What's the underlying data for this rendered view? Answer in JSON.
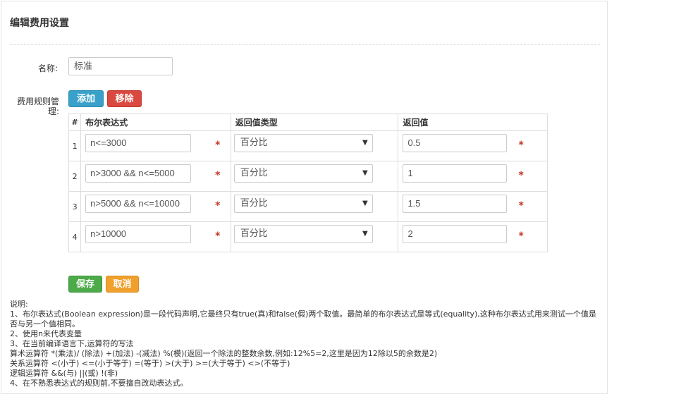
{
  "panel": {
    "title": "编辑费用设置"
  },
  "form": {
    "name_label": "名称:",
    "name_value": "标准",
    "rules_label": "费用规则管理:",
    "add_label": "添加",
    "remove_label": "移除",
    "save_label": "保存",
    "cancel_label": "取消"
  },
  "table": {
    "headers": {
      "index": "#",
      "expression": "布尔表达式",
      "return_type": "返回值类型",
      "return_value": "返回值"
    },
    "required_mark": "*",
    "rows": [
      {
        "index": "1",
        "expression": "n<=3000",
        "return_type": "百分比",
        "return_value": "0.5"
      },
      {
        "index": "2",
        "expression": "n>3000 && n<=5000",
        "return_type": "百分比",
        "return_value": "1"
      },
      {
        "index": "3",
        "expression": "n>5000 && n<=10000",
        "return_type": "百分比",
        "return_value": "1.5"
      },
      {
        "index": "4",
        "expression": "n>10000",
        "return_type": "百分比",
        "return_value": "2"
      }
    ]
  },
  "notes": [
    "说明:",
    "1、布尔表达式(Boolean expression)是一段代码声明,它最终只有true(真)和false(假)两个取值。最简单的布尔表达式是等式(equality),这种布尔表达式用来测试一个值是否与另一个值相同。",
    "2、使用n来代表变量",
    "3、在当前编译语言下,运算符的写法",
    "算术运算符 *(乘法)/ (除法) +(加法) -(减法) %(模)(返回一个除法的整数余数,例如:12%5=2,这里是因为12除以5的余数是2)",
    "关系运算符 <(小于) <=(小于等于) =(等于) >(大于) >=(大于等于) <>(不等于)",
    "逻辑运算符 &&(与) ||(或) !(非)",
    "4、在不熟悉表达式的规则前,不要擅自改动表达式。"
  ]
}
